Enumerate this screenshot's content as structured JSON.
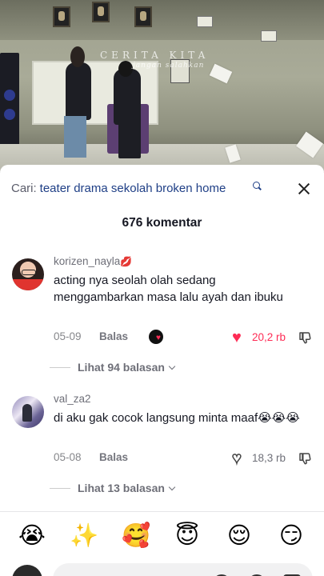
{
  "video": {
    "watermark_title": "CERITA KITA",
    "watermark_subtitle": "jangan salahkan"
  },
  "comments_panel": {
    "search_label": "Cari:",
    "search_term": "teater drama sekolah broken home",
    "comment_count": "676 komentar",
    "comments": [
      {
        "username": "korizen_nayla",
        "username_emoji": "💋",
        "text": "acting nya seolah olah sedang menggambarkan masa lalu ayah dan ibuku",
        "date": "05-09",
        "reply_label": "Balas",
        "creator_liked": true,
        "liked": true,
        "like_count": "20,2 rb",
        "view_replies": "Lihat 94 balasan"
      },
      {
        "username": "val_za2",
        "username_emoji": "",
        "text": "di aku gak cocok langsung minta maaf😭😭😭",
        "date": "05-08",
        "reply_label": "Balas",
        "creator_liked": false,
        "liked": false,
        "like_count": "18,3 rb",
        "view_replies": "Lihat 13 balasan"
      }
    ],
    "quick_emojis": [
      "😭",
      "✨",
      "🥰",
      "😇",
      "😌",
      "😏"
    ]
  },
  "colors": {
    "accent_like": "#fe2c55",
    "search_term": "#1f3f86"
  },
  "icons": {
    "close": "close-icon",
    "search": "search-icon",
    "like": "heart-icon",
    "dislike": "thumbs-down-icon"
  }
}
